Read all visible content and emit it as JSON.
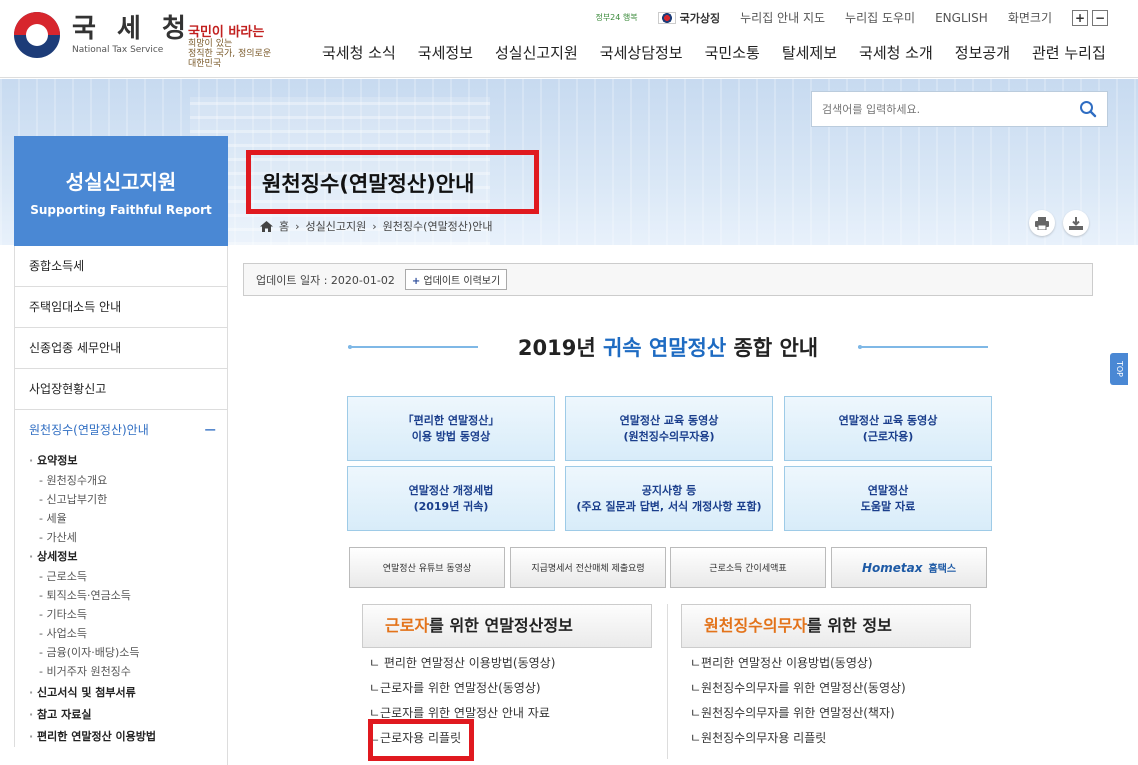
{
  "header": {
    "logo_ko": "국 세 청",
    "logo_en": "National Tax Service",
    "slogan_small": "국민이 바라는",
    "slogan_big": "희망이 있는",
    "slogan_tail": "정직한 국가, 정의로운 대한민국",
    "util_small_logo": "정부24 행복",
    "util_flag": "국가상징",
    "util_links": [
      "누리집 안내 지도",
      "누리집 도우미",
      "ENGLISH",
      "화면크기"
    ],
    "zoom_in": "+",
    "zoom_out": "−",
    "gnb": [
      "국세청 소식",
      "국세정보",
      "성실신고지원",
      "국세상담정보",
      "국민소통",
      "탈세제보",
      "국세청 소개",
      "정보공개",
      "관련 누리집"
    ]
  },
  "search": {
    "placeholder": "검색어를 입력하세요."
  },
  "lnb_title": {
    "ko": "성실신고지원",
    "en": "Supporting Faithful Report"
  },
  "page": {
    "title": "원천징수(연말정산)안내",
    "breadcrumb": [
      "홈",
      "성실신고지원",
      "원천징수(연말정산)안내"
    ]
  },
  "lnb": {
    "items": [
      "종합소득세",
      "주택임대소득 안내",
      "신종업종 세무안내",
      "사업장현황신고"
    ],
    "active": "원천징수(연말정산)안내",
    "active_toggle": "−",
    "groups": [
      {
        "label": "요약정보",
        "leaves": [
          "원천징수개요",
          "신고납부기한",
          "세율",
          "가산세"
        ]
      },
      {
        "label": "상세정보",
        "leaves": [
          "근로소득",
          "퇴직소득·연금소득",
          "기타소득",
          "사업소득",
          "금융(이자·배당)소득",
          "비거주자 원천징수"
        ]
      },
      {
        "label": "신고서식 및 첨부서류",
        "leaves": []
      },
      {
        "label": "참고 자료실",
        "leaves": []
      },
      {
        "label": "편리한 연말정산 이용방법",
        "leaves": []
      }
    ]
  },
  "update": {
    "label": "업데이트 일자 : 2020-01-02",
    "button": "업데이트 이력보기",
    "plus": "+"
  },
  "main_title": {
    "pre": "2019년",
    "em": "귀속 연말정산",
    "post": "종합 안내"
  },
  "boxes": [
    "「편리한 연말정산」\n이용 방법 동영상",
    "연말정산 교육 동영상\n(원천징수의무자용)",
    "연말정산 교육 동영상\n(근로자용)",
    "연말정산 개정세법\n(2019년 귀속)",
    "공지사항 등\n(주요 질문과 답변, 서식 개정사항 포함)",
    "연말정산\n도움말 자료"
  ],
  "gray_buttons": [
    "연말정산 유튜브 동영상",
    "지급명세서 전산매체 제출요령",
    "근로소득 간이세액표"
  ],
  "hometax": {
    "logo": "Hometax",
    "label": "홈택스"
  },
  "left_section": {
    "title_em": "근로자",
    "title_rest": "를 위한 연말정산정보",
    "links": [
      "ㄴ 편리한 연말정산 이용방법(동영상)",
      "ㄴ근로자를 위한 연말정산(동영상)",
      "ㄴ근로자를 위한 연말정산 안내 자료",
      "ㄴ근로자용 리플릿"
    ]
  },
  "right_section": {
    "title_em": "원천징수의무자",
    "title_rest": "를 위한 정보",
    "links": [
      "ㄴ편리한 연말정산 이용방법(동영상)",
      "ㄴ원천징수의무자를 위한 연말정산(동영상)",
      "ㄴ원천징수의무자를 위한 연말정산(책자)",
      "ㄴ원천징수의무자용 리플릿"
    ]
  },
  "top_tab": "TOP",
  "colors": {
    "brand_blue": "#4a88d4",
    "highlight_red": "#e0191f",
    "accent_orange": "#e3731a"
  }
}
